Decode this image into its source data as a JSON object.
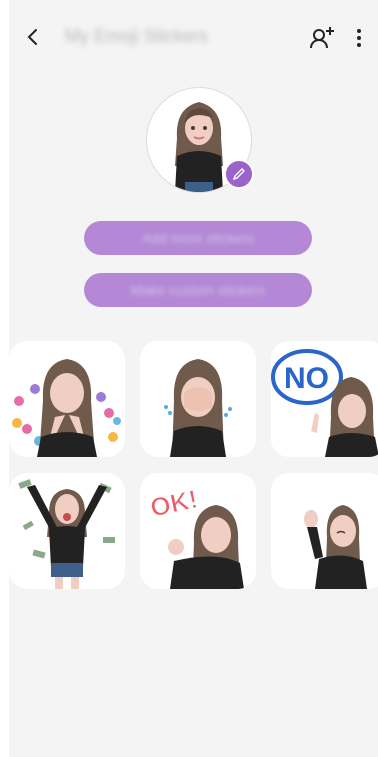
{
  "header": {
    "title": "My Emoji Stickers",
    "back_icon": "back-chevron-icon",
    "add_icon": "add-person-icon",
    "more_icon": "more-vertical-icon"
  },
  "profile": {
    "edit_icon": "pencil-icon"
  },
  "actions": {
    "add_label": "Add more stickers",
    "make_label": "Make custom stickers"
  },
  "stickers": {
    "no_text": "NO",
    "ok_text": "OK!"
  },
  "colors": {
    "accent": "#b488d6",
    "badge": "#9a63c9",
    "background": "#f4f4f4"
  }
}
